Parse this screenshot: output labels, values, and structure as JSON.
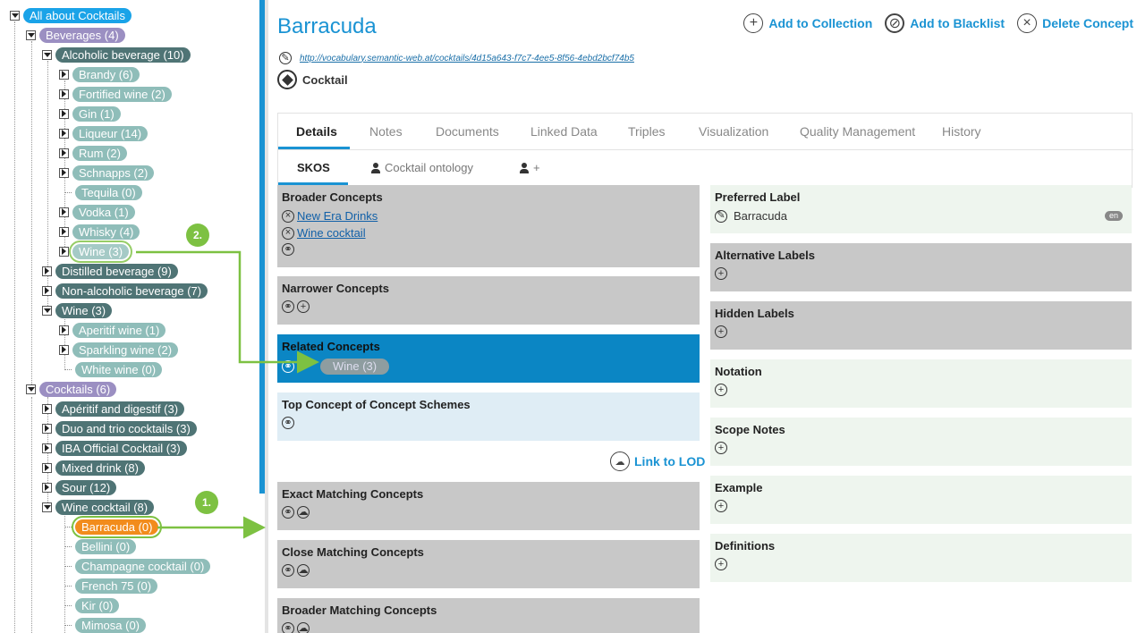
{
  "tree": {
    "root": "All about Cocktails",
    "beverages": "Beverages (4)",
    "alcoholic": "Alcoholic beverage (10)",
    "brandy": "Brandy (6)",
    "fortified": "Fortified wine (2)",
    "gin": "Gin (1)",
    "liqueur": "Liqueur (14)",
    "rum": "Rum (2)",
    "schnapps": "Schnapps (2)",
    "tequila": "Tequila (0)",
    "vodka": "Vodka (1)",
    "whisky": "Whisky (4)",
    "wine_sub": "Wine (3)",
    "distilled": "Distilled beverage (9)",
    "nonalcoholic": "Non-alcoholic beverage (7)",
    "wine": "Wine (3)",
    "aperitif_wine": "Aperitif wine (1)",
    "sparkling": "Sparkling wine (2)",
    "white_wine": "White wine (0)",
    "cocktails": "Cocktails (6)",
    "aperitif_digestif": "Apéritif and digestif (3)",
    "duo_trio": "Duo and trio cocktails (3)",
    "iba": "IBA Official Cocktail (3)",
    "mixed": "Mixed drink (8)",
    "sour": "Sour (12)",
    "wine_cocktail": "Wine cocktail (8)",
    "barracuda": "Barracuda (0)",
    "bellini": "Bellini (0)",
    "champagne": "Champagne cocktail (0)",
    "french75": "French 75 (0)",
    "kir": "Kir (0)",
    "mimosa": "Mimosa (0)"
  },
  "concept": {
    "title": "Barracuda",
    "uri": "http://vocabulary.semantic-web.at/cocktails/4d15a643-f7c7-4ee5-8f56-4ebd2bcf74b5",
    "type": "Cocktail"
  },
  "actions": {
    "add_collection": "Add to Collection",
    "add_blacklist": "Add to Blacklist",
    "delete": "Delete Concept"
  },
  "tabs": [
    "Details",
    "Notes",
    "Documents",
    "Linked Data",
    "Triples",
    "Visualization",
    "Quality Management",
    "History"
  ],
  "subtabs": {
    "skos": "SKOS",
    "ontology": "Cocktail ontology",
    "add": "+"
  },
  "left_panels": {
    "broader": "Broader Concepts",
    "broader_items": [
      "New Era Drinks",
      "Wine cocktail"
    ],
    "narrower": "Narrower Concepts",
    "related": "Related Concepts",
    "related_drag": "Wine (3)",
    "top_concept": "Top Concept of Concept Schemes",
    "link_lod": "Link to LOD",
    "exact": "Exact Matching Concepts",
    "close": "Close Matching Concepts",
    "broad_match": "Broader Matching Concepts"
  },
  "right_panels": {
    "pref_label": "Preferred Label",
    "pref_value": "Barracuda",
    "lang": "en",
    "alt_labels": "Alternative Labels",
    "hidden_labels": "Hidden Labels",
    "notation": "Notation",
    "scope_notes": "Scope Notes",
    "example": "Example",
    "definitions": "Definitions"
  },
  "markers": {
    "one": "1.",
    "two": "2."
  },
  "colors": {
    "accent": "#1a93d3",
    "selected": "#f28c1c",
    "marker": "#7dc142"
  }
}
